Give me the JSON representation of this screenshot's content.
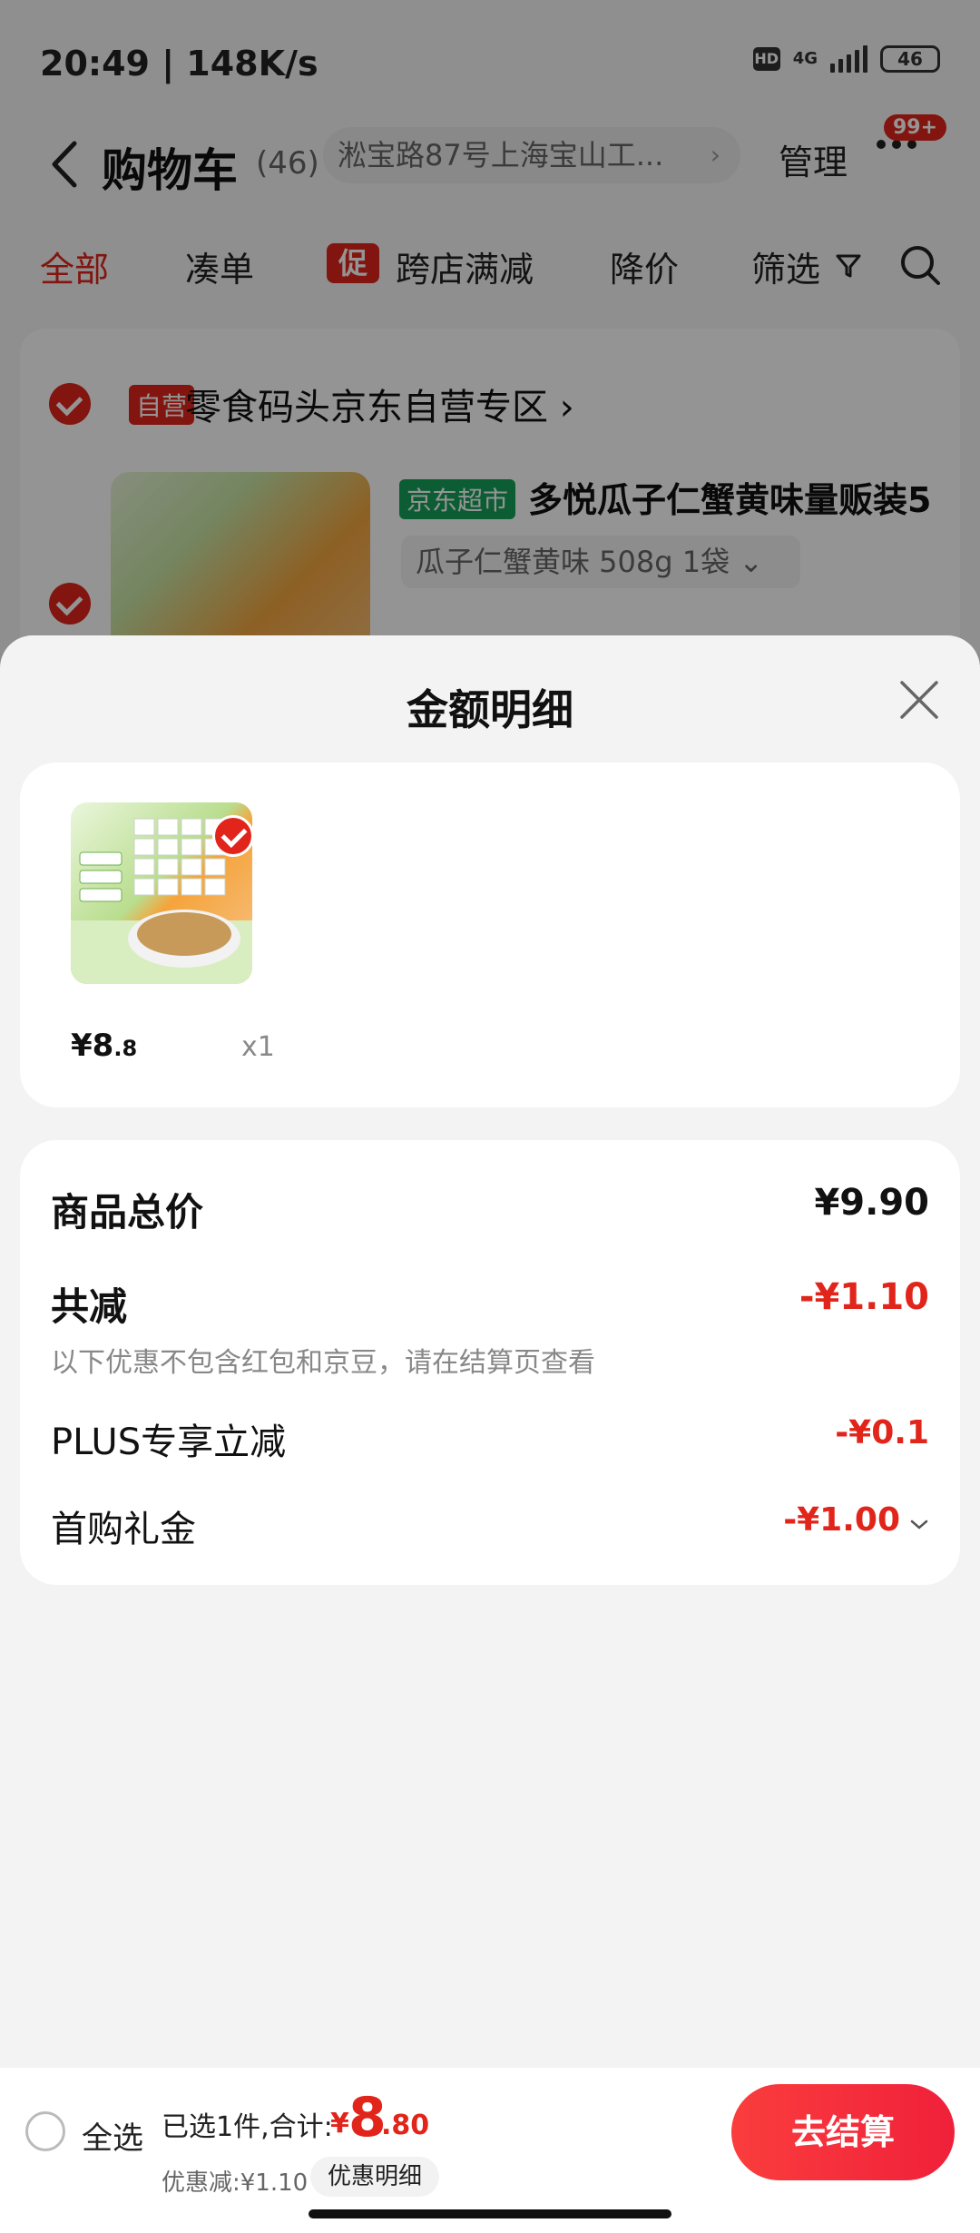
{
  "status_bar": {
    "time_speed": "20:49 | 148K/s",
    "hd": "HD",
    "network": "4G",
    "battery": "46"
  },
  "cart_header": {
    "title": "购物车",
    "count": "(46)",
    "address": "淞宝路87号上海宝山工...",
    "manage": "管理",
    "badge": "99+"
  },
  "filters": {
    "all": "全部",
    "combine": "凑单",
    "promo_badge": "促",
    "cross_store": "跨店满减",
    "price_drop": "降价",
    "filter": "筛选"
  },
  "store": {
    "self_tag": "自营",
    "name": "零食码头京东自营专区 ›",
    "market_tag": "京东超市",
    "product_name": "多悦瓜子仁蟹黄味量贩装5",
    "spec": "瓜子仁蟹黄味 508g 1袋  ⌄"
  },
  "sheet": {
    "title": "金额明细",
    "item": {
      "price_main": "¥8",
      "price_decimal": ".8",
      "qty": "x1"
    },
    "total_label": "商品总价",
    "total_value": "¥9.90",
    "reduce_label": "共减",
    "reduce_value": "-¥1.10",
    "note": "以下优惠不包含红包和京豆，请在结算页查看",
    "plus_label": "PLUS专享立减",
    "plus_value": "-¥0.1",
    "first_label": "首购礼金",
    "first_value": "-¥1.00"
  },
  "checkout": {
    "select_all": "全选",
    "summary": "已选1件,合计:",
    "symbol": "¥",
    "int": "8",
    "decimal": ".80",
    "discount": "优惠减:¥1.10",
    "discount_detail": "优惠明细",
    "button": "去结算"
  },
  "colors": {
    "accent_red": "#e1251b",
    "market_green": "#18a15a"
  }
}
